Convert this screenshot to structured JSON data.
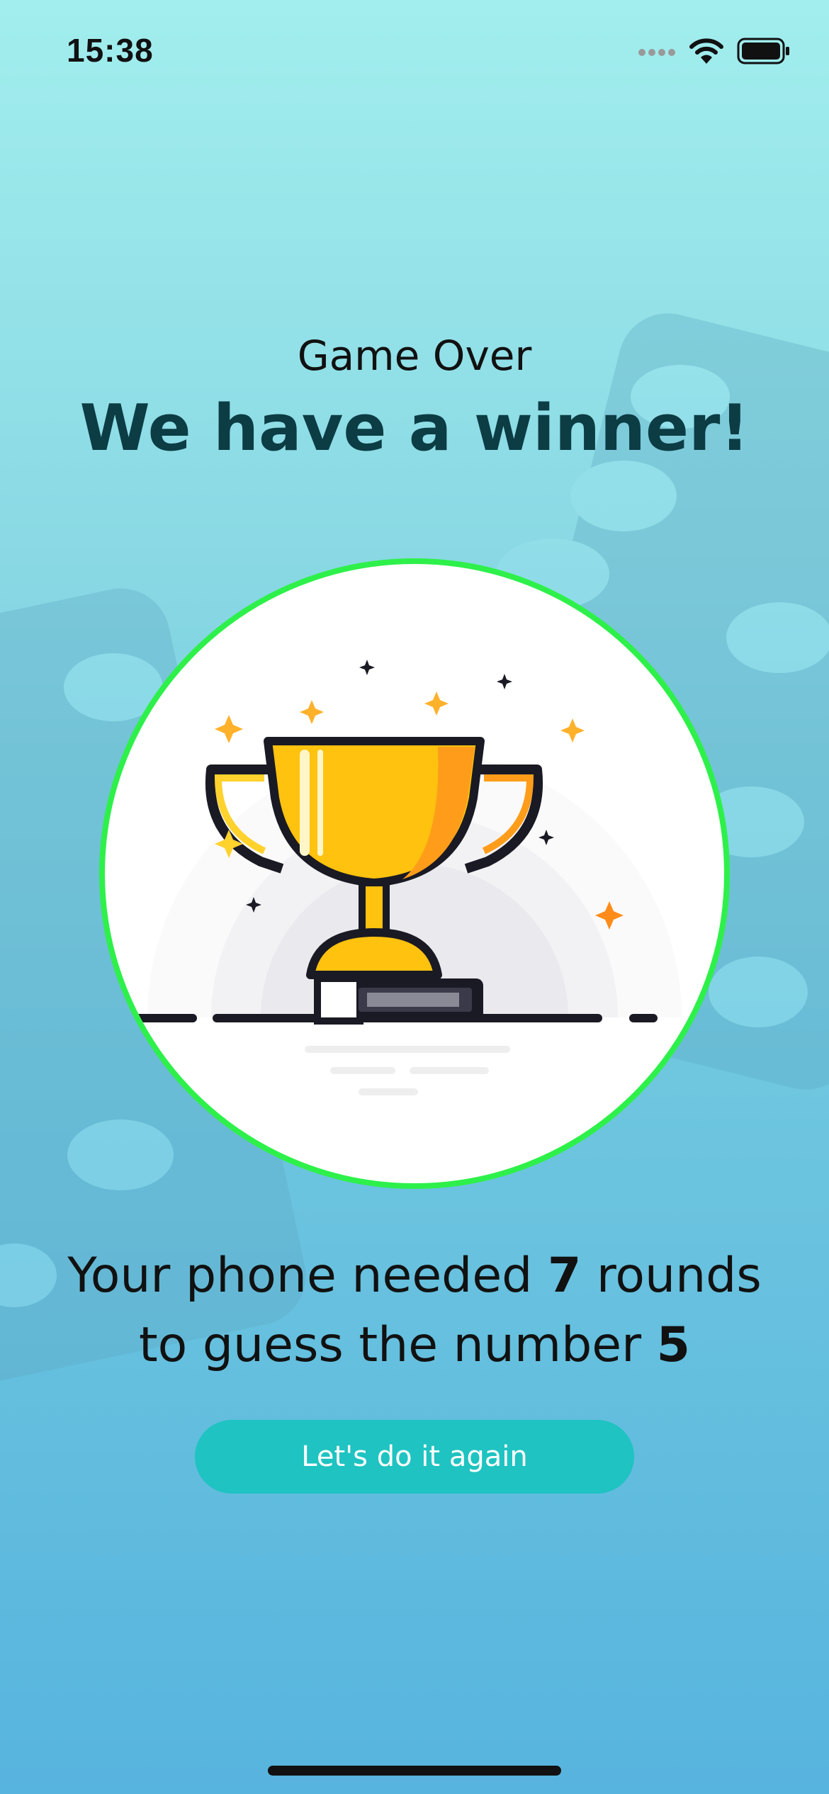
{
  "status_bar": {
    "time": "15:38",
    "icons": [
      "signal-icon",
      "wifi-icon",
      "battery-icon"
    ]
  },
  "header": {
    "subtitle": "Game Over",
    "title": "We have a winner!"
  },
  "image": {
    "icon": "trophy-icon"
  },
  "result": {
    "prefix": "Your phone needed ",
    "rounds": "7",
    "middle": " rounds",
    "line2_prefix": "to guess the number ",
    "number": "5"
  },
  "actions": {
    "again_label": "Let's do it again"
  },
  "colors": {
    "circle_border": "#2ef04a",
    "button": "#1fc3c1",
    "title": "#0c3c44"
  }
}
